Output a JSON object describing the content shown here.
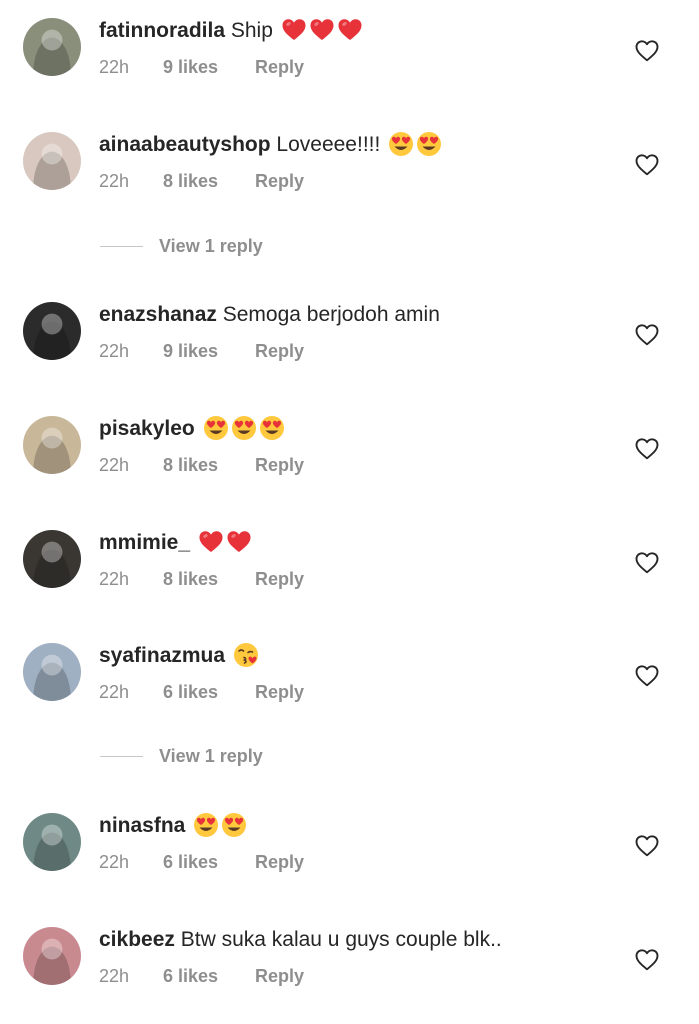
{
  "comments": [
    {
      "username": "fatinnoradila",
      "text": "Ship",
      "emojis": [
        "red-heart",
        "red-heart",
        "red-heart"
      ],
      "time": "22h",
      "likes": "9 likes",
      "reply": "Reply",
      "avatar_color": "#8a8f7c"
    },
    {
      "username": "ainaabeautyshop",
      "text": "Loveeee!!!!",
      "emojis": [
        "heart-eyes",
        "heart-eyes"
      ],
      "time": "22h",
      "likes": "8 likes",
      "reply": "Reply",
      "avatar_color": "#d8c8bf"
    },
    {
      "username": "enazshanaz",
      "text": "Semoga berjodoh amin",
      "emojis": [],
      "time": "22h",
      "likes": "9 likes",
      "reply": "Reply",
      "avatar_color": "#2b2b2b"
    },
    {
      "username": "pisakyleo",
      "text": "",
      "emojis": [
        "heart-eyes",
        "heart-eyes",
        "heart-eyes"
      ],
      "time": "22h",
      "likes": "8 likes",
      "reply": "Reply",
      "avatar_color": "#c9b79a"
    },
    {
      "username": "mmimie_",
      "text": "",
      "emojis": [
        "red-heart",
        "red-heart"
      ],
      "time": "22h",
      "likes": "8 likes",
      "reply": "Reply",
      "avatar_color": "#3a3733"
    },
    {
      "username": "syafinazmua",
      "text": "",
      "emojis": [
        "kissing-heart"
      ],
      "time": "22h",
      "likes": "6 likes",
      "reply": "Reply",
      "avatar_color": "#9fb0c2"
    },
    {
      "username": "ninasfna",
      "text": "",
      "emojis": [
        "heart-eyes",
        "heart-eyes"
      ],
      "time": "22h",
      "likes": "6 likes",
      "reply": "Reply",
      "avatar_color": "#6f8a86"
    },
    {
      "username": "cikbeez",
      "text": "Btw suka kalau u guys couple blk..",
      "emojis": [],
      "time": "22h",
      "likes": "6 likes",
      "reply": "Reply",
      "avatar_color": "#c98a8f"
    }
  ],
  "view_replies": [
    {
      "label": "View 1 reply"
    },
    {
      "label": "View 1 reply"
    }
  ],
  "colors": {
    "text": "#262626",
    "secondary": "#8e8e8e",
    "divider": "#c7c7c7",
    "heart_red": "#e8323a",
    "emoji_yellow": "#ffc83d"
  }
}
